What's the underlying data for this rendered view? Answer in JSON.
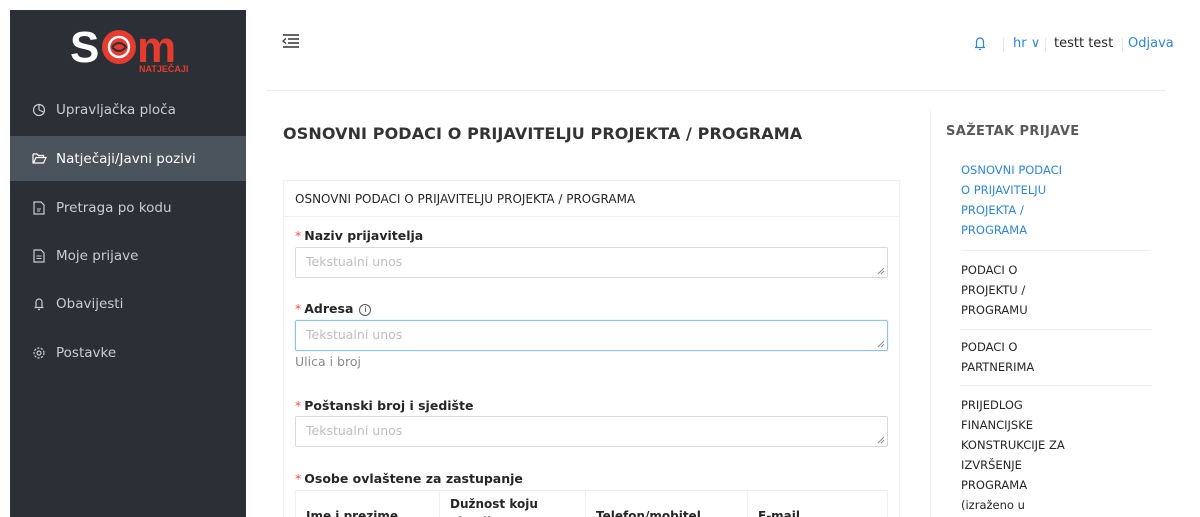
{
  "logo": {
    "initials": "S",
    "m": "m",
    "subtitle": "NATJEČAJI"
  },
  "sidebar": {
    "items": [
      {
        "label": "Upravljačka ploča",
        "icon": "dashboard-icon"
      },
      {
        "label": "Natječaji/Javni pozivi",
        "icon": "folder-open-icon",
        "active": true
      },
      {
        "label": "Pretraga po kodu",
        "icon": "file-search-icon"
      },
      {
        "label": "Moje prijave",
        "icon": "document-icon"
      },
      {
        "label": "Obavijesti",
        "icon": "bell-icon"
      },
      {
        "label": "Postavke",
        "icon": "gear-icon"
      }
    ]
  },
  "header": {
    "language": "hr ∨",
    "user": "testt test",
    "logout": "Odjava"
  },
  "page": {
    "title": "OSNOVNI PODACI O PRIJAVITELJU PROJEKTA / PROGRAMA",
    "card_title": "OSNOVNI PODACI O PRIJAVITELJU PROJEKTA / PROGRAMA"
  },
  "form": {
    "required_mark": "*",
    "fields": [
      {
        "label": "Naziv prijavitelja",
        "placeholder": "Tekstualni unos"
      },
      {
        "label": "Adresa",
        "placeholder": "Tekstualni unos",
        "hint": "Ulica i broj",
        "info": "i"
      },
      {
        "label": "Poštanski broj i sjedište",
        "placeholder": "Tekstualni unos"
      }
    ],
    "table_label": "Osobe ovlaštene za zastupanje",
    "table_headers": [
      "Ime i prezime",
      "Dužnost koju obavlja",
      "Telefon/mobitel",
      "E-mail"
    ]
  },
  "summary": {
    "title": "SAŽETAK PRIJAVE",
    "items": [
      {
        "lines": [
          "OSNOVNI PODACI",
          "O PRIJAVITELJU",
          "PROJEKTA /",
          "PROGRAMA"
        ],
        "active": true
      },
      {
        "lines": [
          "PODACI O",
          "PROJEKTU /",
          "PROGRAMU"
        ]
      },
      {
        "lines": [
          "PODACI O",
          "PARTNERIMA"
        ]
      },
      {
        "lines": [
          "PRIJEDLOG",
          "FINANCIJSKE",
          "KONSTRUKCIJE ZA",
          "IZVRŠENJE",
          "PROGRAMA",
          "(izraženo u"
        ]
      }
    ]
  },
  "colors": {
    "sidebar": "#2b3036",
    "active_nav": "#4b535c",
    "brand_red": "#e63b2e",
    "link_blue": "#2f86d6",
    "required": "#ff4d4f"
  }
}
